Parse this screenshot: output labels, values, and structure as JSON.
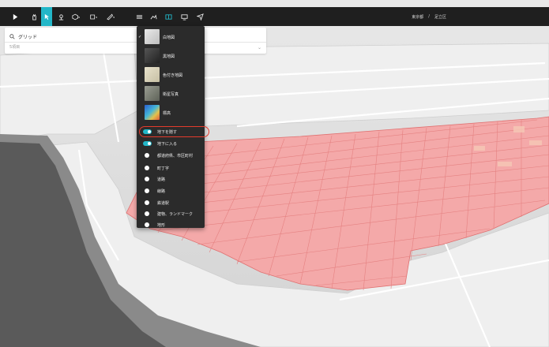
{
  "breadcrumb": {
    "prefecture": "東京都",
    "separator": "/",
    "ward": "足立区"
  },
  "search": {
    "icon": "search-icon",
    "query": "グリッド",
    "hint": "5項目"
  },
  "toolbar": {
    "buttons": [
      "logo-icon",
      "hand-icon",
      "pointer-icon",
      "pin-icon",
      "cube-icon",
      "shape-icon",
      "measure-icon",
      "layers-icon",
      "terrain-icon",
      "book-icon",
      "screen-icon",
      "send-icon"
    ]
  },
  "basemap_menu": {
    "items": [
      {
        "label": "白地図",
        "selected": true,
        "color": "#c8c8c8"
      },
      {
        "label": "黒地図",
        "selected": false,
        "color": "#3a3a3a"
      },
      {
        "label": "色付き地図",
        "selected": false,
        "color": "#d9d2b8"
      },
      {
        "label": "衛星写真",
        "selected": false,
        "color": "#7c7f74"
      },
      {
        "label": "標高",
        "selected": false,
        "color": "#3a7ad1"
      }
    ],
    "layers": [
      {
        "label": "地下を隠す",
        "type": "toggle",
        "on": true
      },
      {
        "label": "地下に入る",
        "type": "toggle",
        "on": true
      },
      {
        "label": "都道府県、市区町村",
        "type": "dot"
      },
      {
        "label": "町丁字",
        "type": "dot"
      },
      {
        "label": "道路",
        "type": "dot"
      },
      {
        "label": "線路",
        "type": "dot"
      },
      {
        "label": "鉄道駅",
        "type": "dot"
      },
      {
        "label": "建物、ランドマーク",
        "type": "dot"
      },
      {
        "label": "地形",
        "type": "dot"
      }
    ]
  },
  "colors": {
    "accent": "#23b7c8",
    "toolbar": "#1f1f1f",
    "menu": "#2b2b2b",
    "grid": "#f28a8a",
    "highlight": "#e53b2c"
  }
}
